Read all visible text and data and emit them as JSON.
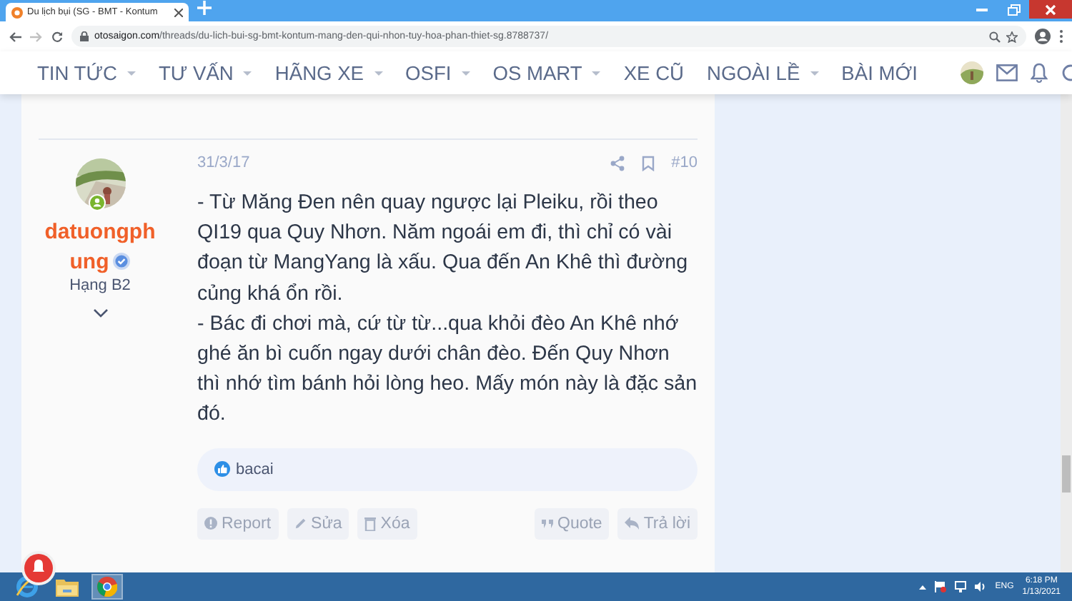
{
  "browser": {
    "tab_title": "Du lịch bụi (SG - BMT - Kontum",
    "url_host": "otosaigon.com",
    "url_path": "/threads/du-lich-bui-sg-bmt-kontum-mang-den-qui-nhon-tuy-hoa-phan-thiet-sg.8788737/"
  },
  "nav": {
    "items": [
      {
        "label": "TIN TỨC",
        "dropdown": true
      },
      {
        "label": "TƯ VẤN",
        "dropdown": true
      },
      {
        "label": "HÃNG XE",
        "dropdown": true
      },
      {
        "label": "OSFI",
        "dropdown": true
      },
      {
        "label": "OS MART",
        "dropdown": true
      },
      {
        "label": "XE CŨ",
        "dropdown": false
      },
      {
        "label": "NGOÀI LỀ",
        "dropdown": true
      },
      {
        "label": "BÀI MỚI",
        "dropdown": false
      }
    ]
  },
  "post": {
    "author": {
      "name": "datuongphung",
      "rank": "Hạng B2",
      "online": true,
      "verified": true
    },
    "date": "31/3/17",
    "number": "#10",
    "paragraphs": [
      "- Từ Măng Đen nên quay ngược lại Pleiku, rồi theo QI19 qua Quy Nhơn. Năm ngoái em đi, thì chỉ có vài đoạn từ MangYang là xấu. Qua đến An Khê thì đường củng khá ổn rồi.",
      "- Bác đi chơi mà, cứ từ từ...qua khỏi đèo An Khê nhớ ghé ăn bì cuốn ngay dưới chân đèo. Đến Quy Nhơn thì nhớ tìm bánh hỏi lòng heo. Mấy món này là đặc sản đó."
    ],
    "reactions": {
      "users": "bacai"
    },
    "actions": {
      "left": [
        {
          "label": "Report",
          "kind": "report"
        },
        {
          "label": "Sửa",
          "kind": "edit"
        },
        {
          "label": "Xóa",
          "kind": "delete"
        }
      ],
      "right": [
        {
          "label": "Quote",
          "kind": "quote"
        },
        {
          "label": "Trả lời",
          "kind": "reply"
        }
      ]
    }
  },
  "taskbar": {
    "language": "ENG",
    "time": "6:18 PM",
    "date": "1/13/2021"
  }
}
